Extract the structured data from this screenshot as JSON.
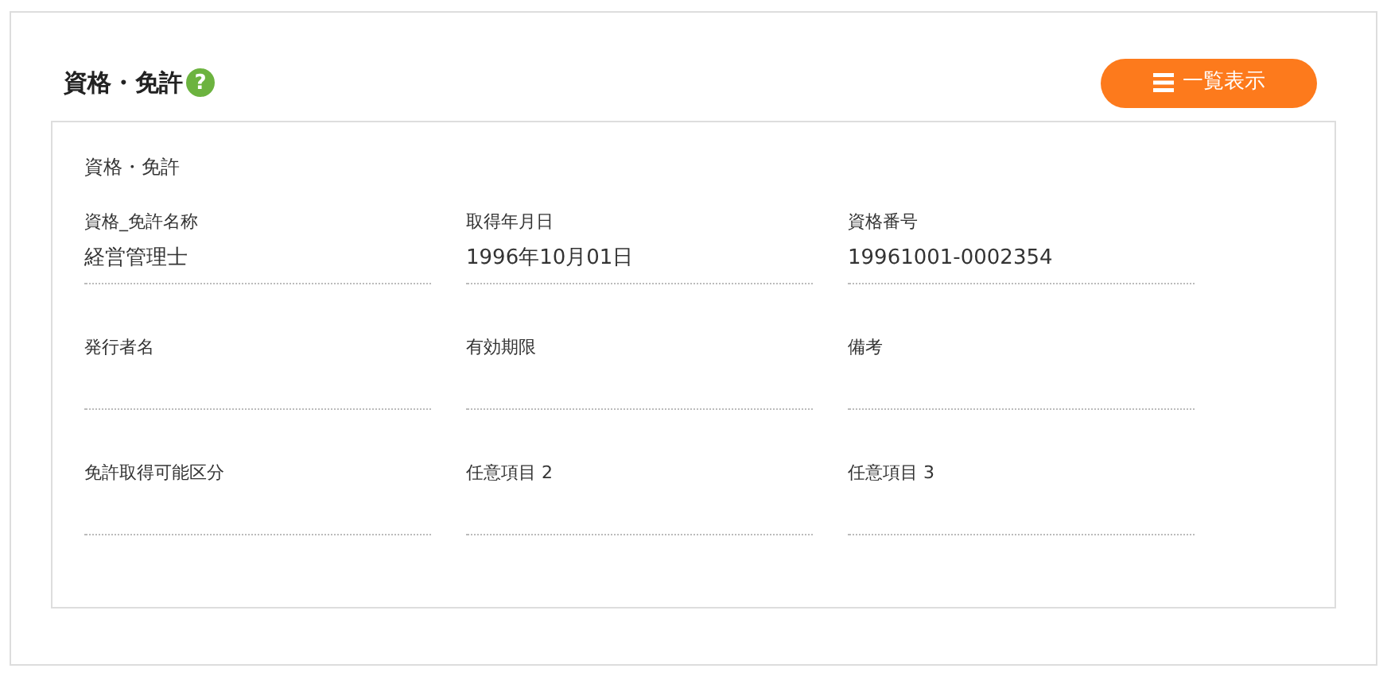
{
  "section": {
    "title": "資格・免許",
    "help_icon": "?",
    "list_button": {
      "label": "一覧表示"
    }
  },
  "panel": {
    "title": "資格・免許",
    "fields": [
      {
        "label": "資格_免許名称",
        "value": "経営管理士"
      },
      {
        "label": "取得年月日",
        "value": "1996年10月01日"
      },
      {
        "label": "資格番号",
        "value": "19961001-0002354"
      },
      {
        "label": "発行者名"
      },
      {
        "label": "有効期限"
      },
      {
        "label": "備考"
      },
      {
        "label": "免許取得可能区分"
      },
      {
        "label": "任意項目 2"
      },
      {
        "label": "任意項目 3"
      }
    ]
  }
}
